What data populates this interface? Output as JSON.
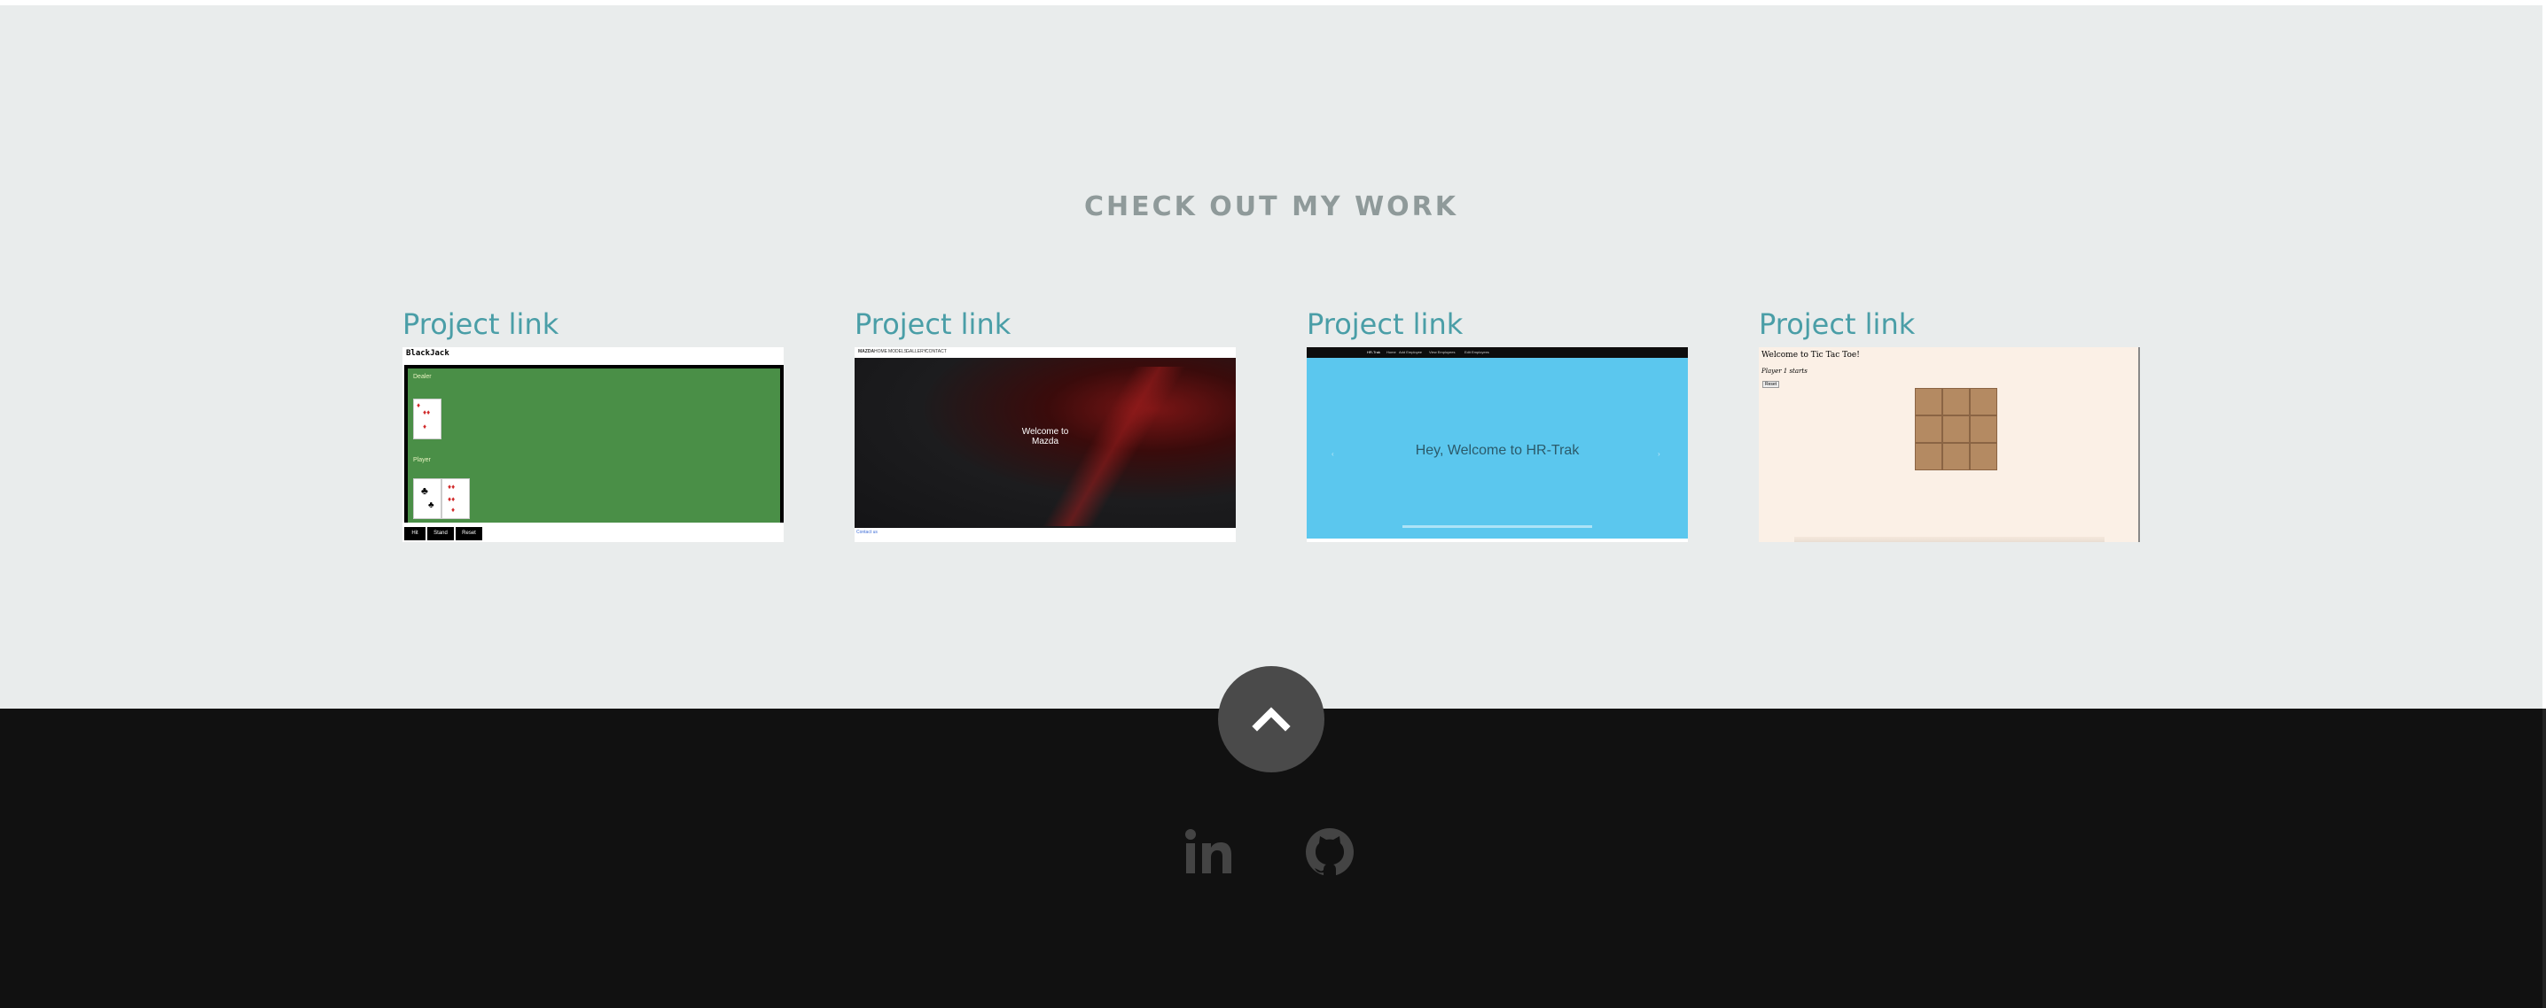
{
  "section": {
    "title": "CHECK OUT MY WORK"
  },
  "projects": [
    {
      "link_label": "Project link",
      "preview": {
        "title": "BlackJack",
        "dealer_label": "Dealer",
        "player_label": "Player",
        "buttons": [
          "Hit",
          "Stand",
          "Reset"
        ]
      }
    },
    {
      "link_label": "Project link",
      "preview": {
        "nav": [
          "MAZDA",
          "HOME",
          "MODELS",
          "GALLERY",
          "CONTACT"
        ],
        "welcome_line1": "Welcome to",
        "welcome_line2": "Mazda",
        "foot_link": "Contact us"
      }
    },
    {
      "link_label": "Project link",
      "preview": {
        "nav": [
          "HR-Trak",
          "Home",
          "Add Employee",
          "View Employees",
          "Edit Employees"
        ],
        "welcome": "Hey, Welcome to HR-Trak"
      }
    },
    {
      "link_label": "Project link",
      "preview": {
        "title": "Welcome to Tic Tac Toe!",
        "status": "Player 1 starts",
        "reset": "Reset"
      }
    }
  ],
  "footer": {
    "scroll_top_icon": "chevron-up-icon",
    "social": [
      {
        "icon": "linkedin-icon"
      },
      {
        "icon": "github-icon"
      }
    ]
  },
  "colors": {
    "background": "#e9ecec",
    "accent": "#4a9ea7",
    "title": "#8f9a9a",
    "footer": "#111111",
    "scroll_button": "#4a4a4a",
    "social_icon": "#444444"
  }
}
